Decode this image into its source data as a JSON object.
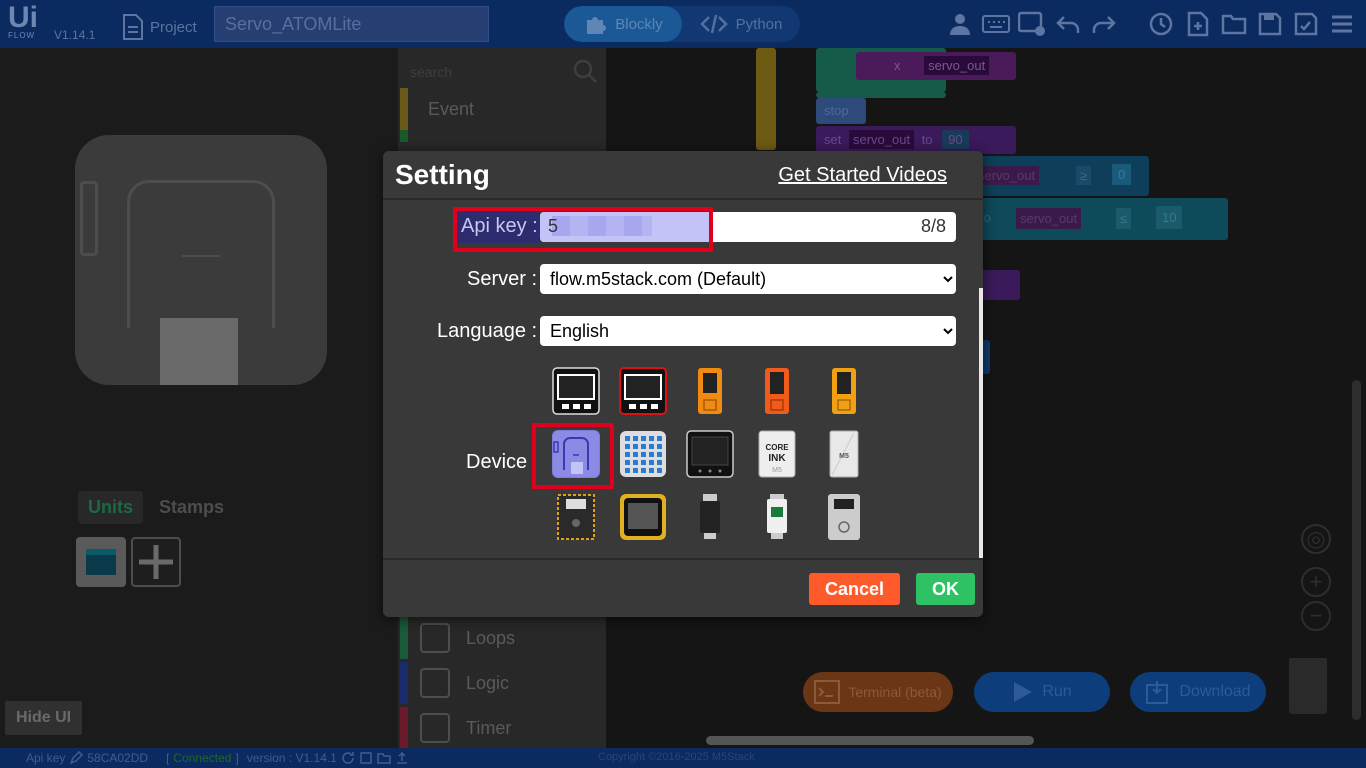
{
  "app": {
    "logo": "Ui",
    "logo_sub": "FLOW",
    "version": "V1.14.1",
    "project_label": "Project",
    "project_name": "Servo_ATOMLite",
    "modes": [
      "Blockly",
      "Python"
    ],
    "active_mode": "Blockly"
  },
  "left_panel": {
    "tabs": [
      "Units",
      "Stamps"
    ],
    "active_tab": "Units",
    "hide_ui": "Hide UI"
  },
  "blockly_menu": {
    "search_placeholder": "search",
    "categories": [
      {
        "label": "Event",
        "color": "#6a5a1a"
      },
      {
        "label": "Loops",
        "color": "#1a5a3a"
      },
      {
        "label": "Logic",
        "color": "#1a2a6a"
      },
      {
        "label": "Timer",
        "color": "#6a1a2a"
      }
    ]
  },
  "workspace": {
    "blocks": {
      "servo_out": "servo_out",
      "stop": "stop",
      "set": "set",
      "to": "to",
      "value_90": "90",
      "value_0": "0",
      "value_10": "10",
      "op_gte": "≥",
      "op_lte": "≤",
      "op_x": "x"
    },
    "terminal_button": "Terminal (beta)",
    "run_button": "Run",
    "download_button": "Download"
  },
  "statusbar": {
    "api_key_label": "Api key",
    "api_key_value": "58CA02DD",
    "connection": "Connected",
    "version_label": "version : V1.14.1",
    "copyright": "Copyright ©2016-2025 M5Stack"
  },
  "modal": {
    "title": "Setting",
    "link": "Get Started Videos",
    "api_key_label": "Api key :",
    "api_key_first_char": "5",
    "api_key_count": "8/8",
    "server_label": "Server :",
    "server_value": "flow.m5stack.com (Default)",
    "language_label": "Language :",
    "language_value": "English",
    "device_label": "Device",
    "cancel": "Cancel",
    "ok": "OK",
    "selected_device": "atom-lite",
    "accent_colors": {
      "cancel": "#ff5a2a",
      "ok": "#2ec264",
      "highlight": "#e0001b"
    }
  }
}
